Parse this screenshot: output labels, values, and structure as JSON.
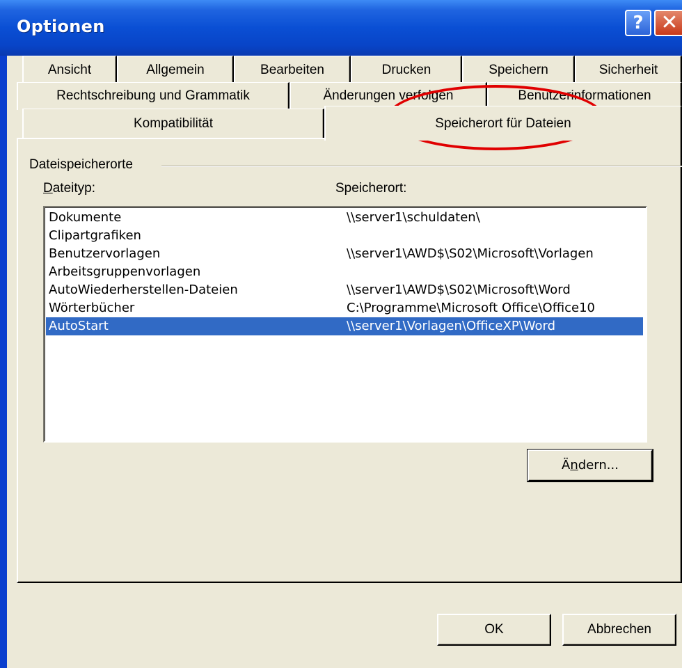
{
  "window": {
    "title": "Optionen"
  },
  "titlebar_buttons": {
    "help": "?",
    "close": "✕"
  },
  "tabs": {
    "row1": [
      "Ansicht",
      "Allgemein",
      "Bearbeiten",
      "Drucken",
      "Speichern",
      "Sicherheit"
    ],
    "row2": [
      "Rechtschreibung und Grammatik",
      "Änderungen verfolgen",
      "Benutzerinformationen"
    ],
    "row3": [
      "Kompatibilität",
      "Speicherort für Dateien"
    ],
    "active": "Speicherort für Dateien"
  },
  "group": {
    "title": "Dateispeicherorte"
  },
  "columns": {
    "type_prefix": "D",
    "type_rest": "ateityp:",
    "location": "Speicherort:"
  },
  "list": [
    {
      "type": "Dokumente",
      "location": "\\\\server1\\schuldaten\\"
    },
    {
      "type": "Clipartgrafiken",
      "location": ""
    },
    {
      "type": "Benutzervorlagen",
      "location": "\\\\server1\\AWD$\\S02\\Microsoft\\Vorlagen"
    },
    {
      "type": "Arbeitsgruppenvorlagen",
      "location": ""
    },
    {
      "type": "AutoWiederherstellen-Dateien",
      "location": "\\\\server1\\AWD$\\S02\\Microsoft\\Word"
    },
    {
      "type": "Wörterbücher",
      "location": "C:\\Programme\\Microsoft Office\\Office10"
    },
    {
      "type": "AutoStart",
      "location": "\\\\server1\\Vorlagen\\OfficeXP\\Word",
      "selected": true
    }
  ],
  "buttons": {
    "change_prefix": "Ä",
    "change_accel": "n",
    "change_rest": "dern...",
    "ok": "OK",
    "cancel": "Abbrechen"
  },
  "colors": {
    "highlight": "#316ac5",
    "annotation": "#e00000",
    "face": "#ece9d8"
  }
}
